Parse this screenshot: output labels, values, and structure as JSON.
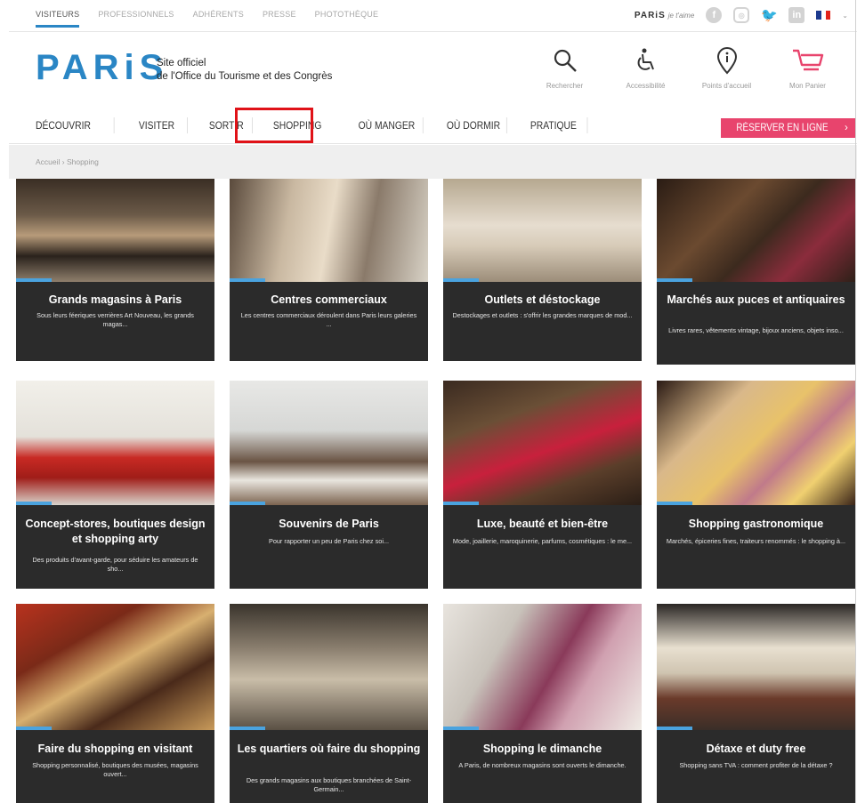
{
  "topbar": {
    "links": [
      "VISITEURS",
      "PROFESSIONNELS",
      "ADHÉRENTS",
      "PRESSE",
      "PHOTOTHÈQUE"
    ],
    "mini_logo": "PARiS",
    "mini_logo_script": "je t'aime"
  },
  "header": {
    "logo": "PARiS",
    "tagline_1": "Site officiel",
    "tagline_2": "de l'Office du Tourisme et des Congrès",
    "tools": [
      {
        "label": "Rechercher",
        "icon": "search-icon"
      },
      {
        "label": "Accessibilité",
        "icon": "wheelchair-icon"
      },
      {
        "label": "Points d'accueil",
        "icon": "info-pin-icon"
      },
      {
        "label": "Mon Panier",
        "icon": "cart-icon"
      }
    ]
  },
  "nav": {
    "items": [
      "DÉCOUVRIR",
      "VISITER",
      "SORTIR",
      "SHOPPING",
      "OÙ MANGER",
      "OÙ DORMIR",
      "PRATIQUE"
    ],
    "active": "SHOPPING",
    "book_label": "RÉSERVER EN LIGNE",
    "book_arrow": "›"
  },
  "breadcrumb": "Accueil › Shopping",
  "colors": {
    "brand_blue": "#2a86c5",
    "book_pink": "#e8446d",
    "highlight_red": "#e01218",
    "card_bg": "#2b2b2b"
  },
  "cards": [
    {
      "title": "Grands magasins à Paris",
      "desc": "Sous leurs féeriques verrières Art Nouveau, les grands magas..."
    },
    {
      "title": "Centres commerciaux",
      "desc": "Les centres commerciaux déroulent dans Paris leurs galeries ..."
    },
    {
      "title": "Outlets et déstockage",
      "desc": "Destockages et outlets : s'offrir les grandes marques de mod..."
    },
    {
      "title": "Marchés aux puces et antiquaires",
      "desc": "Livres rares, vêtements vintage, bijoux anciens, objets inso..."
    },
    {
      "title": "Concept-stores, boutiques design et shopping arty",
      "desc": "Des produits d'avant-garde, pour séduire les amateurs de sho..."
    },
    {
      "title": "Souvenirs de Paris",
      "desc": "Pour rapporter un peu de Paris chez soi..."
    },
    {
      "title": "Luxe, beauté et bien-être",
      "desc": "Mode, joaillerie, maroquinerie, parfums, cosmétiques : le me..."
    },
    {
      "title": "Shopping gastronomique",
      "desc": "Marchés, épiceries fines, traiteurs renommés : le shopping à..."
    },
    {
      "title": "Faire du shopping en visitant",
      "desc": "Shopping personnalisé, boutiques des musées, magasins ouvert..."
    },
    {
      "title": "Les quartiers où faire du shopping",
      "desc": "Des grands magasins aux boutiques branchées de Saint-Germain..."
    },
    {
      "title": "Shopping le dimanche",
      "desc": "A Paris, de nombreux magasins sont ouverts le dimanche."
    },
    {
      "title": "Détaxe et duty free",
      "desc": "Shopping sans TVA : comment profiter de la détaxe ?"
    }
  ]
}
